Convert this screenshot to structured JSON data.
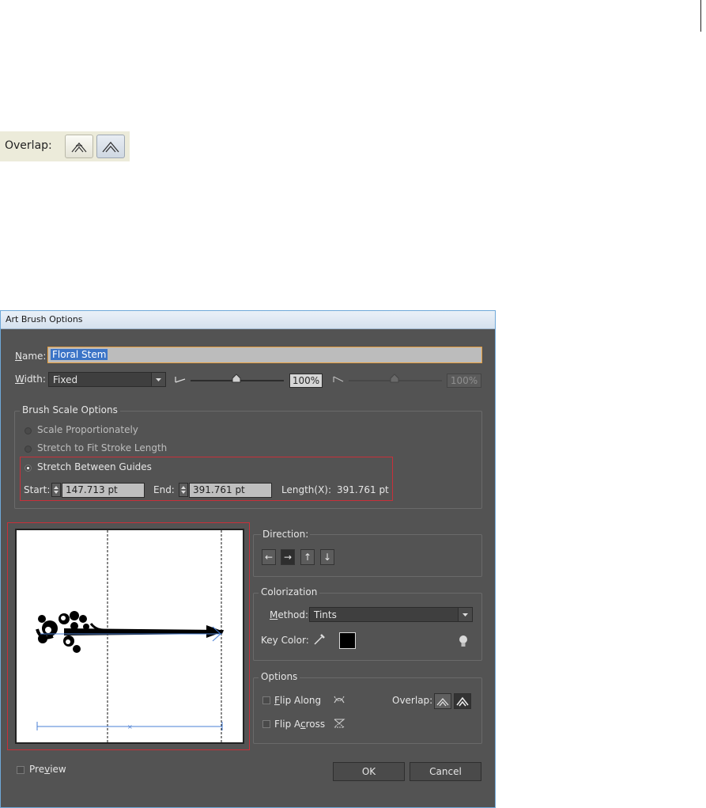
{
  "snippet": {
    "overlap_label": "Overlap:"
  },
  "dialog": {
    "title": "Art Brush Options",
    "name_label": "Name:",
    "name_value": "Floral Stem",
    "width_label": "Width:",
    "width_value": "Fixed",
    "width_pct_1": "100%",
    "width_pct_2": "100%",
    "scale_group_title": "Brush Scale Options",
    "scale_options": [
      "Scale Proportionately",
      "Stretch to Fit Stroke Length",
      "Stretch Between Guides"
    ],
    "scale_selected": "Stretch Between Guides",
    "start_label": "Start:",
    "start_value": "147.713 pt",
    "end_label": "End:",
    "end_value": "391.761 pt",
    "length_label": "Length(X):",
    "length_value": "391.761 pt",
    "direction_label": "Direction:",
    "direction_buttons": [
      "←",
      "→",
      "↑",
      "↓"
    ],
    "direction_selected": "→",
    "colorization_title": "Colorization",
    "method_label": "Method:",
    "method_value": "Tints",
    "key_color_label": "Key Color:",
    "key_color": "#000000",
    "options_title": "Options",
    "flip_along_label": "Flip Along",
    "flip_across_label": "Flip Across",
    "overlap_label": "Overlap:",
    "preview_label": "Preview",
    "ok_label": "OK",
    "cancel_label": "Cancel"
  },
  "colors": {
    "dialog_bg": "#535353",
    "accent": "#c8303a",
    "guide": "#4a7fd4"
  }
}
